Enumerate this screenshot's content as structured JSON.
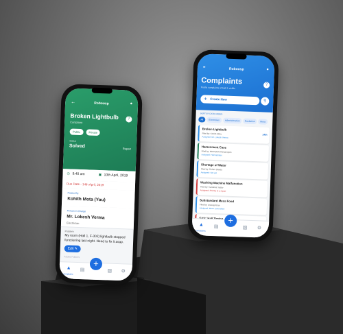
{
  "colors": {
    "green": "#1d7c55",
    "blue": "#1b6fd1",
    "red": "#d23b3b"
  },
  "left_phone": {
    "app_name": "Roboosp",
    "title": "Broken Lightbulb",
    "category": "Complaint",
    "tags": [
      "Public",
      "Private"
    ],
    "status_label": "Status",
    "status": "Solved",
    "report": "Report",
    "time": "9:40 am",
    "date": "10th April, 2019",
    "due_date": "Due Date - 14th April, 2019",
    "posted_by_label": "Posted By",
    "posted_by": "Kohith Mota (You)",
    "person_label": "Person In Charge",
    "person": "Mr. Lokesh Verma",
    "person_role": "Electrician",
    "description_label": "Problem",
    "description": "My room (Hall 1, F-302) lightbulb stopped functioning last night. Need to fix it asap.",
    "edit_label": "Edit",
    "added_label": "Added Folders",
    "nav_home": "Complaints"
  },
  "right_phone": {
    "app_name": "Roboosp",
    "title": "Complaints",
    "subtitle": "Public complaints of Hall 1 visible",
    "create_button": "Create New",
    "sort_label": "SORT BY DATE ADDED",
    "filters": [
      "All",
      "Electrician",
      "Administration",
      "Sanitation",
      "Mess"
    ],
    "items": [
      {
        "title": "Broken Lightbulb",
        "sub": "Filed by: Kohith Mota",
        "sub2": "Assigned: Mr. Lokesh Verma",
        "badge": "14th"
      },
      {
        "title": "Harassment Case",
        "sub": "Filed by: Meenakshi Ramanujam",
        "sub2": "Assigned: Hall Warden",
        "badge": ""
      },
      {
        "title": "Shortage of Water",
        "sub": "Filed by: Rohan Shukla",
        "sub2": "Assigned: Not yet",
        "badge": ""
      },
      {
        "title": "Washing Machine Malfunction",
        "sub": "Filed by: Kanishka Yadav",
        "sub2": "Assigned: Priority to a repair",
        "badge": ""
      },
      {
        "title": "Substandard Mess Food",
        "sub": "Filed by: Anurag Kiran",
        "sub2": "Assigned: Mess Committee",
        "badge": ""
      },
      {
        "title": "Girls' Hall Timing",
        "sub": "Filed by: Anjali Gupta",
        "sub2": "",
        "badge": ""
      }
    ],
    "nav_home": "Complaints"
  }
}
